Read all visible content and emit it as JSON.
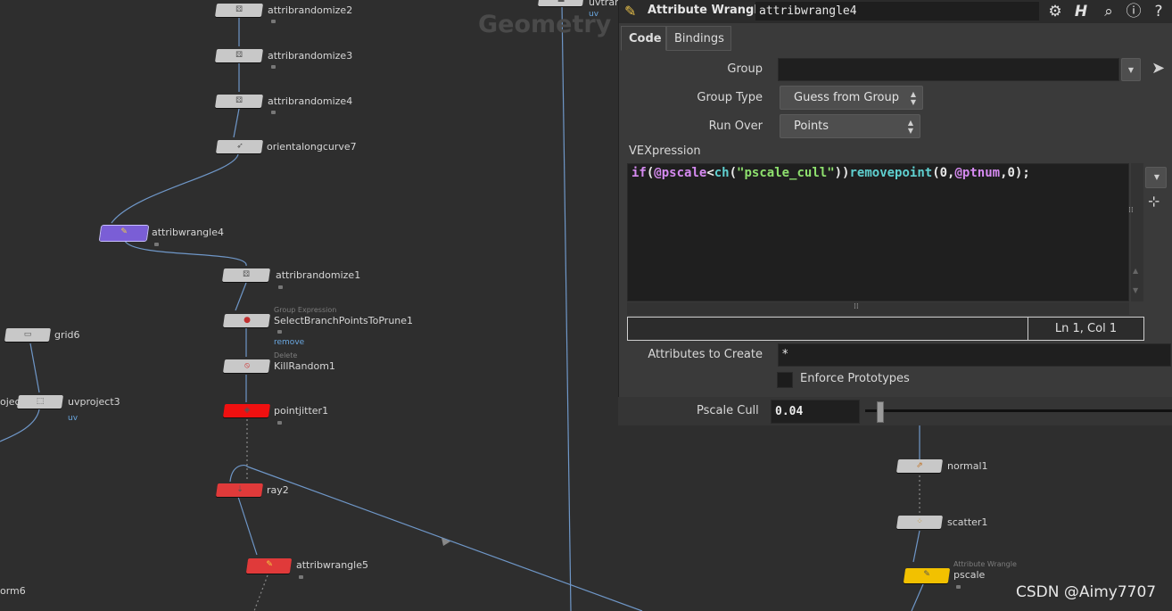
{
  "network": {
    "context_label": "Geometry",
    "nodes": {
      "attribrandomize2": {
        "label": "attribrandomize2"
      },
      "attribrandomize3": {
        "label": "attribrandomize3"
      },
      "attribrandomize4": {
        "label": "attribrandomize4"
      },
      "orientalongcurve7": {
        "label": "orientalongcurve7"
      },
      "attribwrangle4": {
        "label": "attribwrangle4"
      },
      "attribrandomize1": {
        "label": "attribrandomize1"
      },
      "selectbranch": {
        "label": "SelectBranchPointsToPrune1",
        "type_hint": "Group Expression",
        "flag": "remove"
      },
      "killrandom": {
        "label": "KillRandom1",
        "type_hint": "Delete"
      },
      "pointjitter1": {
        "label": "pointjitter1"
      },
      "ray2": {
        "label": "ray2"
      },
      "attribwrangle5": {
        "label": "attribwrangle5"
      },
      "grid6": {
        "label": "grid6"
      },
      "uvproject3": {
        "label": "uvproject3",
        "flag": "uv"
      },
      "uvproject_partial": {
        "label": "ojec"
      },
      "orm6": {
        "label": "orm6"
      },
      "normal1": {
        "label": "normal1"
      },
      "scatter1": {
        "label": "scatter1"
      },
      "pscale": {
        "label": "pscale",
        "type_hint": "Attribute Wrangle"
      },
      "top_partial": {
        "label": "uvtran",
        "flag": "uv"
      }
    }
  },
  "params": {
    "op_type": "Attribute Wrangle",
    "node_name": "attribwrangle4",
    "header_icons": [
      "gear-icon",
      "houdini-help-icon",
      "search-icon",
      "info-icon",
      "help-icon"
    ],
    "tabs": [
      {
        "label": "Code",
        "active": true
      },
      {
        "label": "Bindings",
        "active": false
      }
    ],
    "group_label": "Group",
    "group_value": "",
    "group_type_label": "Group Type",
    "group_type_value": "Guess from Group",
    "run_over_label": "Run Over",
    "run_over_value": "Points",
    "vex_label": "VEXpression",
    "vex_tokens": {
      "t1": "if",
      "t2": "(",
      "t3": "@pscale",
      "t4": "<",
      "t5": "ch",
      "t6": "(",
      "t7": "\"pscale_cull\"",
      "t8": "))",
      "t9": "removepoint",
      "t10": "(0,",
      "t11": "@ptnum",
      "t12": ",0);"
    },
    "cursor_pos": "Ln 1, Col 1",
    "attrs_create_label": "Attributes to Create",
    "attrs_create_value": "*",
    "enforce_label": "Enforce Prototypes",
    "enforce_checked": false,
    "pscale_cull_label": "Pscale Cull",
    "pscale_cull_value": "0.04"
  },
  "watermark": "CSDN @Aimy7707",
  "colors": {
    "accent_purple": "#7a5ed6",
    "bypass_red": "#e03a3a",
    "display_yellow": "#f2c100",
    "wire_blue": "#6f97c8"
  }
}
